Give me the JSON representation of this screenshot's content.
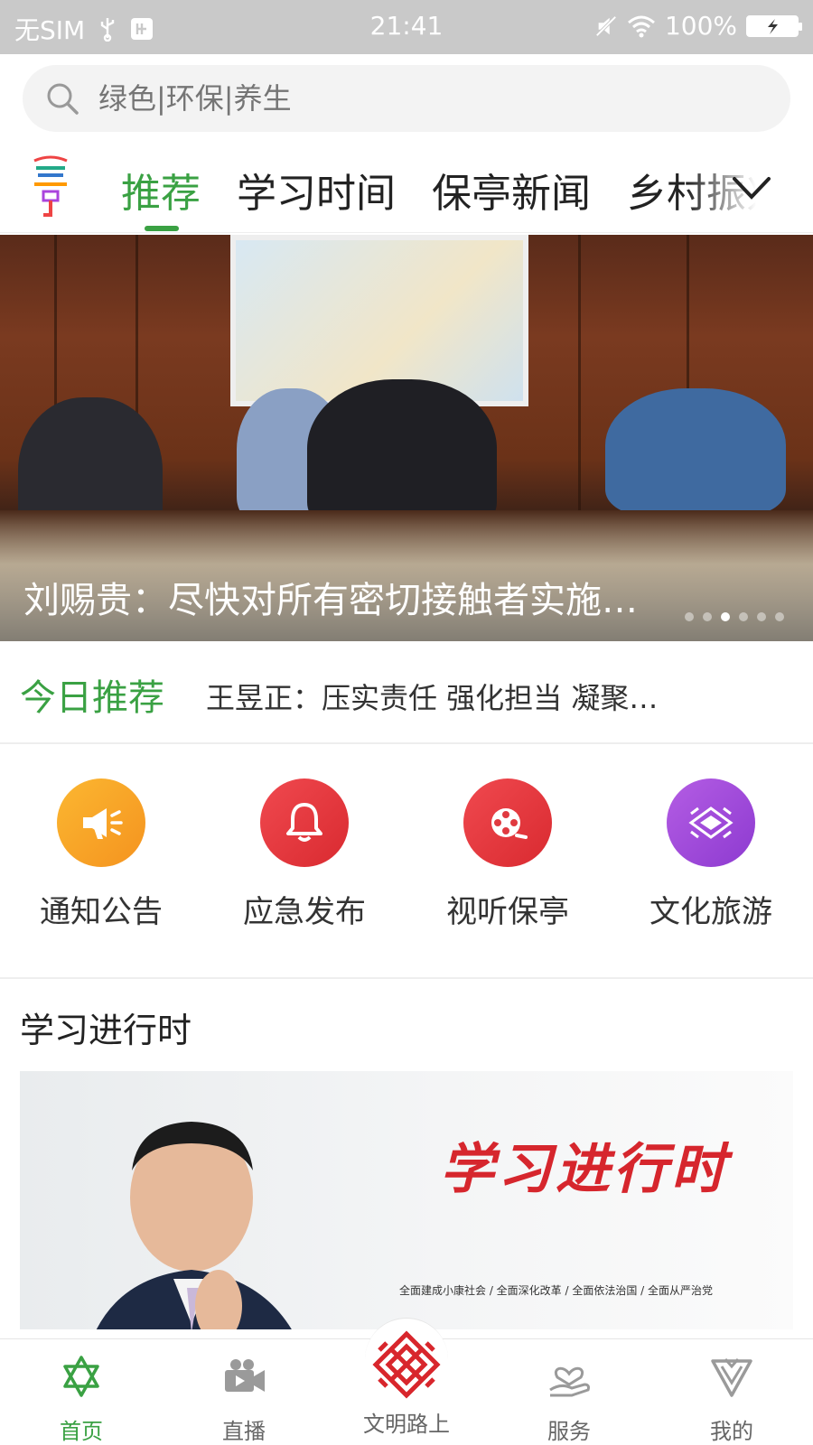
{
  "status_bar": {
    "carrier": "无SIM",
    "time": "21:41",
    "battery": "100%"
  },
  "search": {
    "placeholder": "绿色|环保|养生"
  },
  "tabs": [
    {
      "label": "推荐",
      "active": true
    },
    {
      "label": "学习时间",
      "active": false
    },
    {
      "label": "保亭新闻",
      "active": false
    },
    {
      "label": "乡村振兴",
      "active": false
    }
  ],
  "banner": {
    "caption": "刘赐贵：尽快对所有密切接触者实施…",
    "slide_count": 6,
    "active_slide": 3
  },
  "today": {
    "label": "今日推荐",
    "headline": "王昱正：压实责任 强化担当 凝聚…"
  },
  "shortcuts": [
    {
      "label": "通知公告",
      "icon": "megaphone-icon",
      "color": "#f8a51f"
    },
    {
      "label": "应急发布",
      "icon": "bell-icon",
      "color": "#e8363c"
    },
    {
      "label": "视听保亭",
      "icon": "film-reel-icon",
      "color": "#e8363c"
    },
    {
      "label": "文化旅游",
      "icon": "culture-pattern-icon",
      "color": "#a94fd9"
    }
  ],
  "learning": {
    "title": "学习进行时",
    "banner_title": "学习进行时",
    "banner_sub": "全面建成小康社会  /  全面深化改革  /  全面依法治国  /  全面从严治党"
  },
  "bottom_nav": [
    {
      "label": "首页",
      "icon": "home-star-icon",
      "active": true
    },
    {
      "label": "直播",
      "icon": "video-camera-icon",
      "active": false
    },
    {
      "label": "文明路上",
      "icon": "knot-pattern-icon",
      "active": false
    },
    {
      "label": "服务",
      "icon": "hand-heart-icon",
      "active": false
    },
    {
      "label": "我的",
      "icon": "profile-badge-icon",
      "active": false
    }
  ],
  "colors": {
    "accent": "#3aa143",
    "status_bar": "#c9c9c9",
    "brand_red": "#d6262d"
  }
}
